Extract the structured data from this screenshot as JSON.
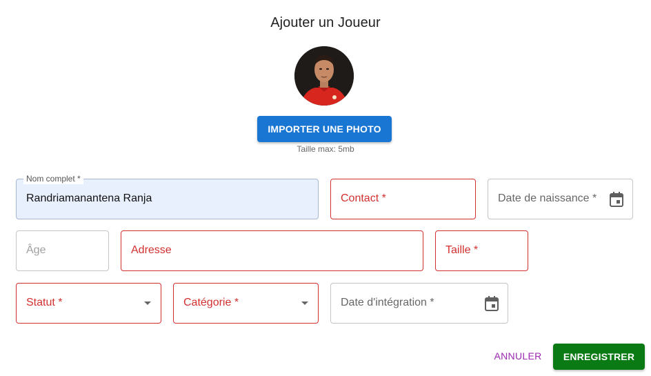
{
  "dialog": {
    "title": "Ajouter un Joueur",
    "upload_button": "IMPORTER UNE PHOTO",
    "upload_helper": "Taille max: 5mb"
  },
  "form": {
    "full_name": {
      "label": "Nom complet *",
      "value": "Randriamanantena Ranja"
    },
    "contact": {
      "label": "Contact *"
    },
    "birth_date": {
      "label": "Date de naissance *",
      "icon": "calendar-icon"
    },
    "age": {
      "placeholder": "Âge"
    },
    "address": {
      "label": "Adresse"
    },
    "height": {
      "label": "Taille *"
    },
    "status": {
      "label": "Statut *",
      "icon": "chevron-down-icon"
    },
    "category": {
      "label": "Catégorie *",
      "icon": "chevron-down-icon"
    },
    "integration_date": {
      "label": "Date d'intégration *",
      "icon": "calendar-icon"
    }
  },
  "actions": {
    "cancel": "ANNULER",
    "save": "ENREGISTRER"
  },
  "colors": {
    "primary": "#1976d2",
    "error": "#d32f2f",
    "save": "#0a7a14",
    "cancel": "#9c27b0",
    "autofill": "#e8f0fe"
  }
}
